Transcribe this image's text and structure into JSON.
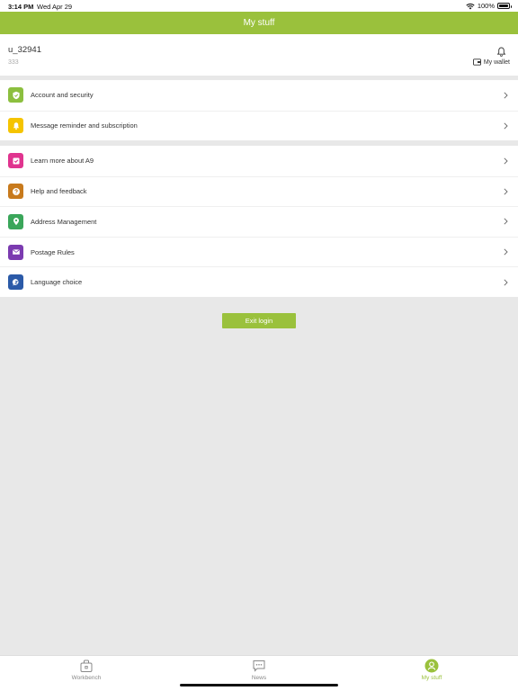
{
  "status": {
    "time": "3:14 PM",
    "date": "Wed Apr 29",
    "battery": "100%",
    "battery_level": 1.0
  },
  "header": {
    "title": "My stuff"
  },
  "profile": {
    "username": "u_32941",
    "user_id": "333",
    "wallet_label": "My wallet"
  },
  "menu_group_1": [
    {
      "label": "Account and security",
      "icon": "shield-icon",
      "color": "#8cbf3f"
    },
    {
      "label": "Message reminder and subscription",
      "icon": "bell-icon",
      "color": "#f5c400"
    }
  ],
  "menu_group_2": [
    {
      "label": "Learn more about A9",
      "icon": "checkbox-icon",
      "color": "#e0348f"
    },
    {
      "label": "Help and feedback",
      "icon": "question-icon",
      "color": "#c87a1c"
    },
    {
      "label": "Address Management",
      "icon": "location-pin-icon",
      "color": "#3aa65a"
    },
    {
      "label": "Postage Rules",
      "icon": "mail-icon",
      "color": "#7b3bb0"
    },
    {
      "label": "Language choice",
      "icon": "chat-bubble-icon",
      "color": "#2b5aa8"
    }
  ],
  "exit_button": {
    "label": "Exit login"
  },
  "tabs": [
    {
      "label": "Workbench",
      "icon": "briefcase-icon",
      "active": false
    },
    {
      "label": "News",
      "icon": "message-icon",
      "active": false
    },
    {
      "label": "My stuff",
      "icon": "person-icon",
      "active": true
    }
  ],
  "colors": {
    "brand": "#9ac13c",
    "background": "#e8e8e8"
  }
}
